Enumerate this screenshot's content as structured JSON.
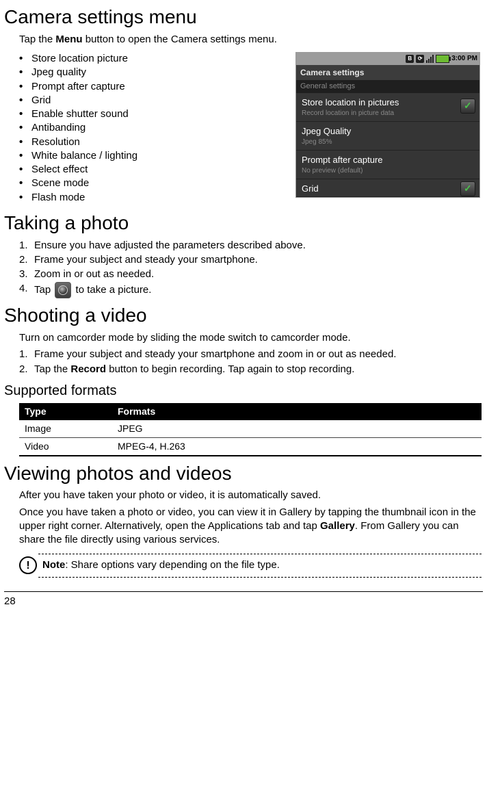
{
  "h_camera_settings": "Camera settings menu",
  "p_tap_menu_pre": "Tap the ",
  "p_tap_menu_bold": "Menu",
  "p_tap_menu_post": " button to open the Camera settings menu.",
  "settings_list": {
    "i0": "Store location picture",
    "i1": "Jpeg quality",
    "i2": "Prompt after capture",
    "i3": "Grid",
    "i4": "Enable shutter sound",
    "i5": "Antibanding",
    "i6": "Resolution",
    "i7": "White balance / lighting",
    "i8": "Select effect",
    "i9": "Scene mode",
    "i10": "Flash mode"
  },
  "screenshot": {
    "time": "3:00 PM",
    "title": "Camera settings",
    "subtitle": "General settings",
    "row0_t": "Store location in pictures",
    "row0_d": "Record location in picture data",
    "row1_t": "Jpeg Quality",
    "row1_d": "Jpeg 85%",
    "row2_t": "Prompt after capture",
    "row2_d": "No preview (default)",
    "row3_t": "Grid"
  },
  "h_taking_photo": "Taking a photo",
  "photo_steps": {
    "s1": "Ensure you have adjusted the parameters described above.",
    "s2": "Frame your subject and steady your smartphone.",
    "s3": "Zoom in or out as needed.",
    "s4_pre": "Tap ",
    "s4_post": " to take a picture."
  },
  "h_shooting_video": "Shooting a video",
  "p_camcorder": "Turn on camcorder mode by sliding the mode switch to camcorder mode.",
  "video_steps": {
    "s1": "Frame your subject and steady your smartphone and zoom in or out as needed.",
    "s2_pre": "Tap the ",
    "s2_bold": "Record",
    "s2_post": " button to begin recording. Tap again to stop recording."
  },
  "h_supported_formats": "Supported formats",
  "table": {
    "h1": "Type",
    "h2": "Formats",
    "r1c1": "Image",
    "r1c2": "JPEG",
    "r2c1": "Video",
    "r2c2": "MPEG-4, H.263"
  },
  "h_viewing": "Viewing photos and videos",
  "p_autosaved": "After you have taken your photo or video, it is automatically saved.",
  "p_gallery_pre": "Once you have taken a photo or video, you can view it in Gallery by tapping the thumbnail icon in the upper right corner. Alternatively, open the Applications tab and tap ",
  "p_gallery_bold": "Gallery",
  "p_gallery_post": ". From Gallery you can share the file directly using various services.",
  "note_bold": "Note",
  "note_text": ": Share options vary depending on the file type.",
  "page_number": "28"
}
